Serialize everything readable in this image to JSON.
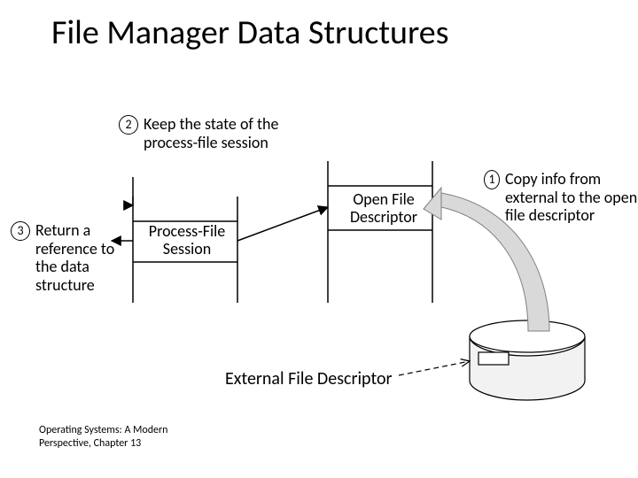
{
  "title": "File Manager Data Structures",
  "footnote_line1": "Operating Systems: A Modern",
  "footnote_line2": "Perspective, Chapter 13",
  "annotations": {
    "a1": {
      "num": "1",
      "text": "Copy info from external to the open file descriptor"
    },
    "a2": {
      "num": "2",
      "text": "Keep the state of the process-file session"
    },
    "a3": {
      "num": "3",
      "text": "Return a reference to the data structure"
    }
  },
  "labels": {
    "process_file_session": "Process-File Session",
    "open_file_descriptor": "Open File Descriptor",
    "external_file_descriptor": "External File Descriptor"
  }
}
